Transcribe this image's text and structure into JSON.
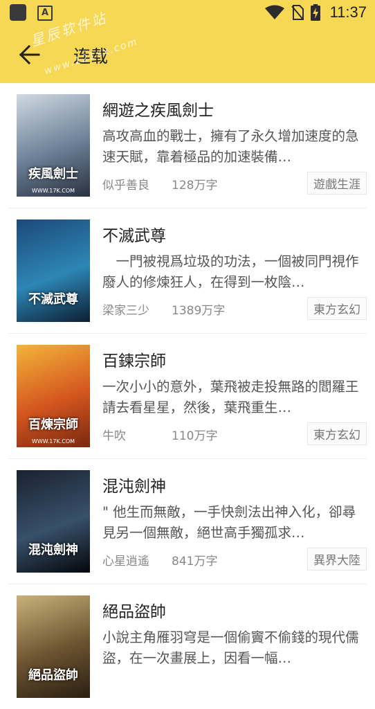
{
  "status_bar": {
    "time": "11:37",
    "left_icons": [
      "app-square-icon",
      "a-badge-icon"
    ],
    "right_icons": [
      "wifi-icon",
      "no-sim-icon",
      "battery-charging-icon"
    ],
    "a_badge_label": "A"
  },
  "toolbar": {
    "title": "连载",
    "back_icon": "arrow-left-icon",
    "background": "#f6d855"
  },
  "watermark": {
    "text": "星辰软件站",
    "url": "www.121xx.com"
  },
  "books": [
    {
      "title": "網遊之疾風劍士",
      "description": "高攻高血的戰士，擁有了永久增加速度的急速天賦，靠着極品的加速裝備…",
      "author": "似乎善良",
      "words": "128万字",
      "category": "遊戲生涯",
      "cover_text": "疾風劍士",
      "cover_url": "WWW.17K.COM",
      "cover_colors": [
        "#cfd9e2",
        "#6b7f96",
        "#2a3140"
      ]
    },
    {
      "title": "不滅武尊",
      "description": "　一門被視爲垃圾的功法，一個被同門視作廢人的修煉狂人，在得到一枚陰…",
      "author": "梁家三少",
      "words": "1389万字",
      "category": "東方玄幻",
      "cover_text": "不滅武尊",
      "cover_url": "",
      "cover_colors": [
        "#1c4a7a",
        "#2d86b5",
        "#0d1e33"
      ]
    },
    {
      "title": "百鍊宗師",
      "description": "一次小小的意外，葉飛被走投無路的閻羅王請去看星星，然後，葉飛重生…",
      "author": "牛吹",
      "words": "110万字",
      "category": "東方玄幻",
      "cover_text": "百煉宗師",
      "cover_url": "WWW.17K.COM",
      "cover_colors": [
        "#f2b43a",
        "#d4561f",
        "#7a2810"
      ]
    },
    {
      "title": "混沌劍神",
      "description": "\" 他生而無敵，一手快劍法出神入化，卻尋見另一個無敵，絕世高手獨孤求…",
      "author": "心星逍遙",
      "words": "841万字",
      "category": "異界大陸",
      "cover_text": "混沌劍神",
      "cover_url": "",
      "cover_colors": [
        "#1b2230",
        "#38506a",
        "#05070b"
      ]
    },
    {
      "title": "絕品盜帥",
      "description": "小說主角雁羽穹是一個偷竇不偷錢的現代儒盜，在一次畫展上，因看一幅…",
      "author": "",
      "words": "",
      "category": "",
      "cover_text": "絕品盜帥",
      "cover_url": "",
      "cover_colors": [
        "#c7b27a",
        "#6b5230",
        "#2a1f12"
      ]
    }
  ]
}
